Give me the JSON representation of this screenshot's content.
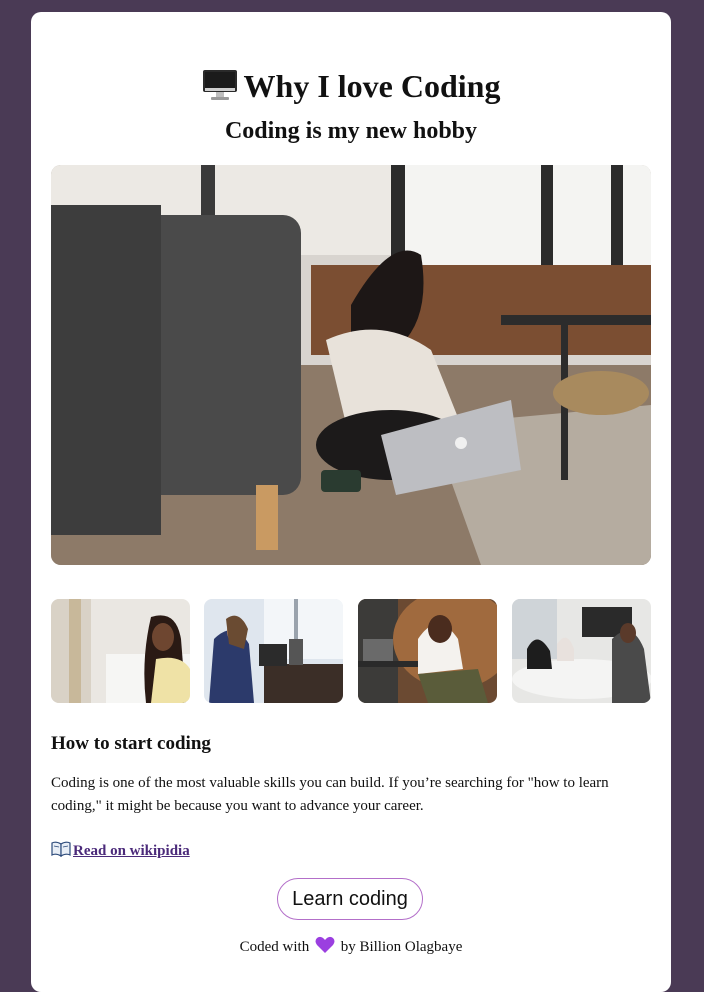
{
  "header": {
    "title": "Why I love Coding",
    "title_icon": "desktop-computer-icon",
    "subtitle": "Coding is my new hobby"
  },
  "images": {
    "hero": "woman-writing-notes-with-laptop-photo",
    "thumbnails": [
      "woman-at-desk-photo",
      "nurse-at-computer-photo",
      "woman-at-table-photo",
      "meeting-room-photo"
    ]
  },
  "section": {
    "heading": "How to start coding",
    "paragraph": "Coding is one of the most valuable skills you can build. If you’re searching for \"how to learn coding,\" it might be because you want to advance your career.",
    "link_icon": "open-book-icon",
    "link_text": "Read on wikipidia"
  },
  "cta": {
    "label": "Learn coding"
  },
  "footer": {
    "prefix": "Coded with",
    "icon": "purple-heart-icon",
    "suffix": "by Billion Olagbaye"
  },
  "colors": {
    "page_background": "#4a3a55",
    "card_background": "#ffffff",
    "link": "#4b2a7a",
    "button_border": "#b36fc9",
    "heart": "#9b3fe0"
  }
}
